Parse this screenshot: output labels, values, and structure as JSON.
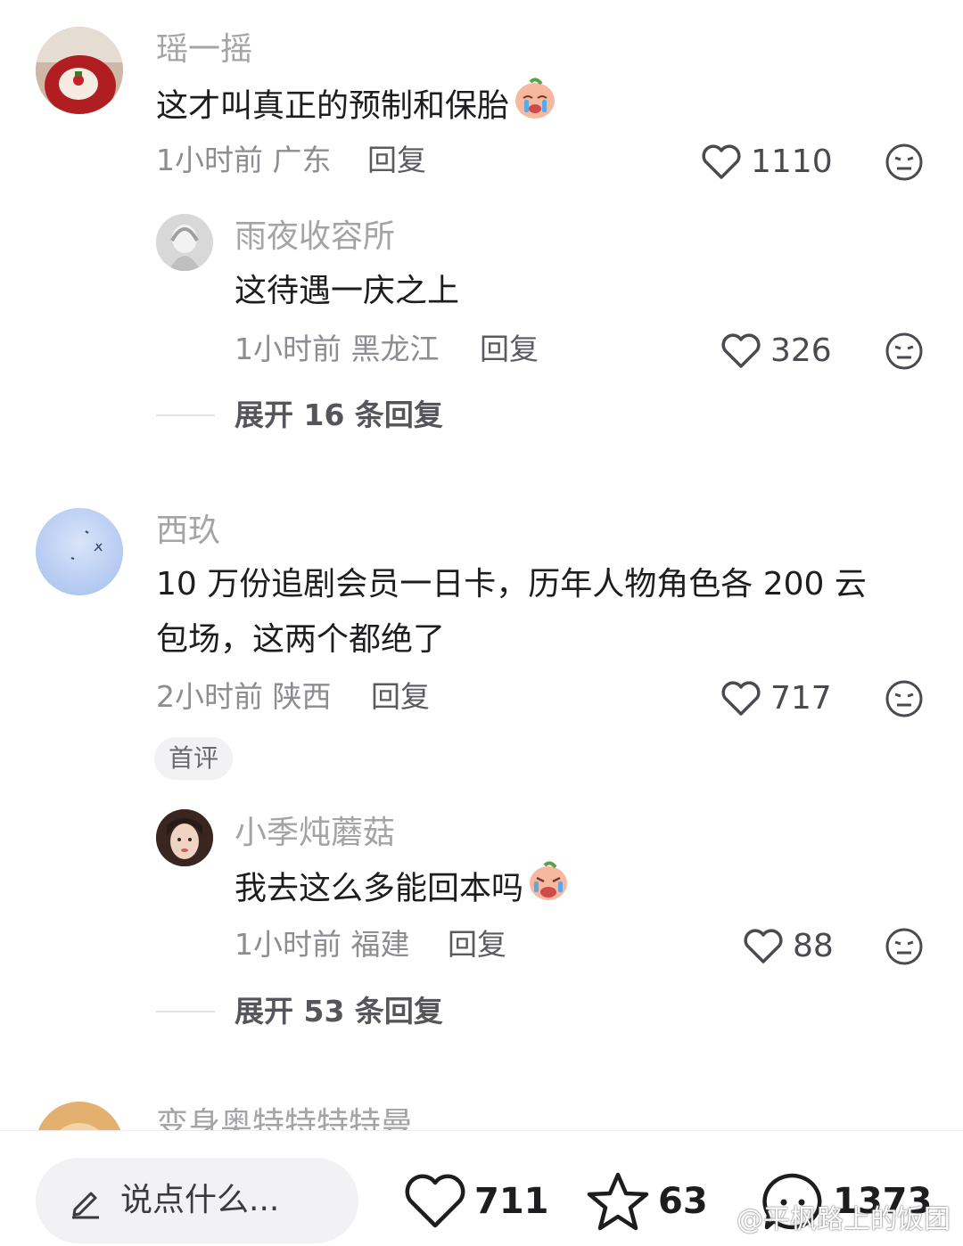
{
  "comments": [
    {
      "username": "瑶一摇",
      "text": "这才叫真正的预制和保胎",
      "time": "1小时前",
      "location": "广东",
      "reply_label": "回复",
      "likes": "1110",
      "emoji": "crying-face-icon",
      "replies": [
        {
          "username": "雨夜收容所",
          "text": "这待遇一庆之上",
          "time": "1小时前",
          "location": "黑龙江",
          "reply_label": "回复",
          "likes": "326"
        }
      ],
      "expand_label": "展开 16 条回复"
    },
    {
      "username": "西玖",
      "text_line1": "10 万份追剧会员一日卡，历年人物角色各 200 云",
      "text_line2": "包场，这两个都绝了",
      "time": "2小时前",
      "location": "陕西",
      "reply_label": "回复",
      "likes": "717",
      "tag": "首评",
      "replies": [
        {
          "username": "小季炖蘑菇",
          "text": "我去这么多能回本吗",
          "time": "1小时前",
          "location": "福建",
          "reply_label": "回复",
          "likes": "88",
          "emoji": "crying-face-icon"
        }
      ],
      "expand_label": "展开 53 条回复"
    },
    {
      "username": "变身奥特特特特曼"
    }
  ],
  "bottom_bar": {
    "input_placeholder": "说点什么...",
    "likes": "711",
    "favorites": "63",
    "comments": "1373"
  },
  "watermark": "@平枫路上的饭团",
  "colors": {
    "username": "#a3a3a8",
    "body_text": "#1d1d1f",
    "meta": "#8c8c92",
    "tag_bg": "#f2f2f4"
  }
}
